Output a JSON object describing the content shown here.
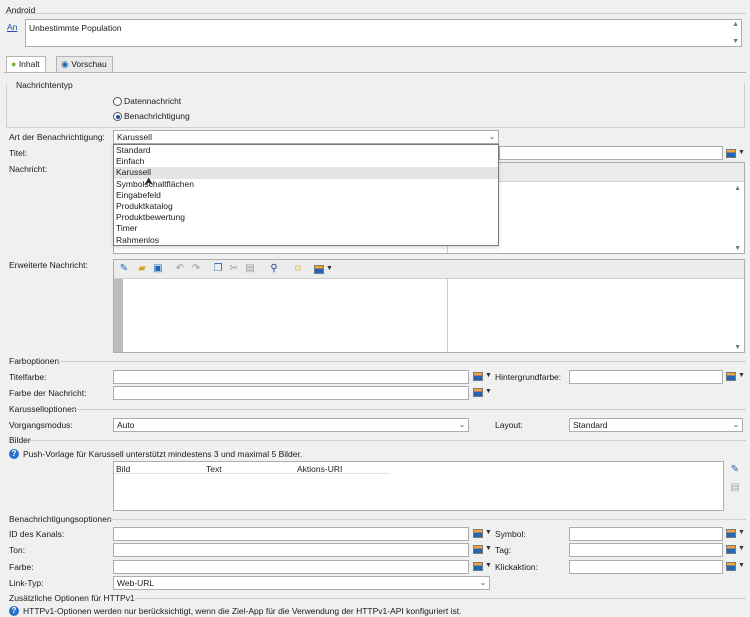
{
  "android_section": {
    "title": "Android",
    "an_link": "An",
    "recipients_value": "Unbestimmte Population"
  },
  "tabs": [
    {
      "label": "Inhalt",
      "icon": "android-icon",
      "active": true
    },
    {
      "label": "Vorschau",
      "icon": "eye-icon",
      "active": false
    }
  ],
  "message_type": {
    "title": "Nachrichtentyp",
    "options": [
      "Datennachricht",
      "Benachrichtigung"
    ],
    "selected": "Benachrichtigung"
  },
  "notification_type": {
    "label": "Art der Benachrichtigung:",
    "value": "Karussell",
    "options": [
      "Standard",
      "Einfach",
      "Karussell",
      "Symbolschaltflächen",
      "Eingabefeld",
      "Produktkatalog",
      "Produktbewertung",
      "Timer",
      "Rahmenlos"
    ],
    "hovered": "Karussell"
  },
  "fields": {
    "title_label": "Titel:",
    "message_label": "Nachricht:",
    "extended_message_label": "Erweiterte Nachricht:"
  },
  "color_options": {
    "title": "Farboptionen",
    "title_color_label": "Titelfarbe:",
    "background_color_label": "Hintergrundfarbe:",
    "message_color_label": "Farbe der Nachricht:"
  },
  "carousel_options": {
    "title": "Karusselloptionen",
    "mode_label": "Vorgangsmodus:",
    "mode_value": "Auto",
    "layout_label": "Layout:",
    "layout_value": "Standard"
  },
  "images": {
    "title": "Bilder",
    "info": "Push-Vorlage für Karussell unterstützt mindestens 3 und maximal 5 Bilder.",
    "columns": [
      "Bild",
      "Text",
      "Aktions-URI"
    ]
  },
  "notification_options": {
    "title": "Benachrichtigungsoptionen",
    "channel_label": "ID des Kanals:",
    "symbol_label": "Symbol:",
    "sound_label": "Ton:",
    "tag_label": "Tag:",
    "color_label": "Farbe:",
    "click_action_label": "Klickaktion:",
    "link_type_label": "Link-Typ:",
    "link_type_value": "Web-URL"
  },
  "httpv1": {
    "title": "Zusätzliche Optionen für HTTPv1",
    "info": "HTTPv1-Optionen werden nur berücksichtigt, wenn die Ziel-App für die Verwendung der HTTPv1-API konfiguriert ist."
  }
}
